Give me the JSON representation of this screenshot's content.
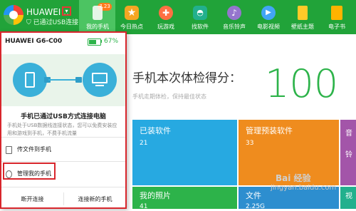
{
  "device": {
    "name": "HUAWEI ..",
    "status": "已通过USB连接"
  },
  "nav": {
    "items": [
      {
        "label": "我的手机",
        "badge": "7.23",
        "color": "#4cc462"
      },
      {
        "label": "今日热点",
        "color": "#f5a623"
      },
      {
        "label": "玩游戏",
        "color": "#ff7043"
      },
      {
        "label": "找软件",
        "color": "#22b08d"
      },
      {
        "label": "音乐铃声",
        "color": "#9575cd"
      },
      {
        "label": "电影视频",
        "color": "#42a5f5"
      },
      {
        "label": "壁纸主题",
        "color": "#ffca28"
      },
      {
        "label": "电子书",
        "color": "#ffb300"
      }
    ]
  },
  "panel": {
    "model": "HUAWEI G6-C00",
    "battery_percent": "67%",
    "battery_level": 0.67,
    "connected_title": "手机已通过USB方式连接电脑",
    "connected_desc": "手机处于USB数据线连接状态，您可以免费安装应用和游戏到手机，不费手机流量",
    "transfer_label": "传文件到手机",
    "manage_label": "管理我的手机",
    "disconnect_label": "断开连接",
    "connect_new_label": "连接新的手机"
  },
  "main": {
    "score_title": "手机本次体检得分：",
    "score_subtitle": "手机走期体检，保持最佳状态",
    "score_value": "100",
    "tiles": [
      {
        "title": "已装软件",
        "value": "21",
        "color": "#27a9e1"
      },
      {
        "title": "管理预装软件",
        "value": "33",
        "color": "#ef8c1e"
      },
      {
        "title": "",
        "value": "",
        "color": "#a355a9"
      },
      {
        "title": "我的照片",
        "value": "41",
        "color": "#2db34a"
      },
      {
        "title": "文件",
        "value": "2.25G",
        "color": "#2d8ecf"
      },
      {
        "title": "",
        "value": "",
        "color": "#22b08d"
      }
    ],
    "partial_chars": [
      "音",
      "铃",
      "视"
    ]
  },
  "watermark": {
    "logo": "Bai 经验",
    "url": "jingyan.baidu.com"
  }
}
